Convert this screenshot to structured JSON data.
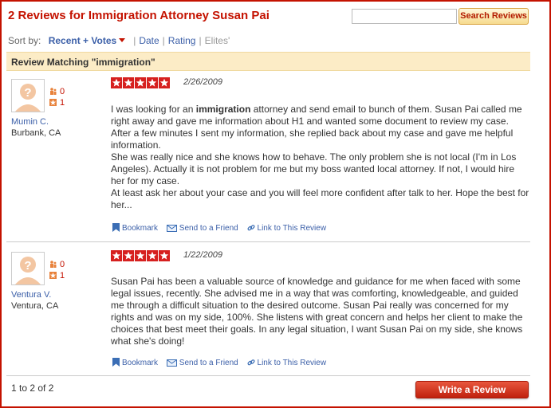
{
  "page": {
    "title": "2 Reviews for Immigration Attorney Susan Pai",
    "search_placeholder": "",
    "search_button": "Search Reviews"
  },
  "sort": {
    "label": "Sort by:",
    "options": [
      "Recent + Votes",
      "Date",
      "Rating",
      "Elites'"
    ],
    "active": "Recent + Votes"
  },
  "match_label": "Review Matching \"immigration\"",
  "reviews": [
    {
      "user_name": "Mumin C.",
      "location": "Burbank, CA",
      "friends": "0",
      "review_count": "1",
      "rating": 5,
      "date": "2/26/2009",
      "text_before_highlight": "I was looking for an ",
      "highlight": "immigration",
      "text_after_highlight": " attorney and send email to bunch of them. Susan Pai called me right away and gave me information about H1 and wanted some document to review my case. After a few minutes I sent my information, she replied back about my case and gave me helpful information.",
      "para2": "She was really nice and she knows how to behave. The only problem she is not local (I'm in Los Angeles). Actually it is not problem for me but my boss wanted local attorney. If not, I would hire her for my case.",
      "para3": "At least ask her about your case and you will feel more confident after talk to her. Hope the best for her..."
    },
    {
      "user_name": "Ventura V.",
      "location": "Ventura, CA",
      "friends": "0",
      "review_count": "1",
      "rating": 5,
      "date": "1/22/2009",
      "para1": "Susan Pai has been a valuable source of knowledge and guidance for me when faced with some legal issues, recently.  She advised me in a way that was comforting, knowledgeable, and guided me through a difficult  situation to the desired outcome. Susan Pai really was concerned for my rights and was on my side, 100%.  She listens with great concern and helps her client to make the choices that best meet their goals.  In any legal situation, I want Susan Pai on my side, she knows what she's doing!"
    }
  ],
  "actions": {
    "bookmark": "Bookmark",
    "send": "Send to a Friend",
    "link": "Link to This Review"
  },
  "footer": {
    "count": "1 to 2 of 2",
    "write_review": "Write a Review"
  },
  "colors": {
    "brand_red": "#c41200",
    "link_blue": "#3b5fa8",
    "match_bg": "#fcecc6"
  },
  "icons": [
    "question-avatar-icon",
    "friends-icon",
    "review-count-icon",
    "star-icon",
    "bookmark-icon",
    "email-icon",
    "link-icon",
    "caret-down-icon"
  ]
}
